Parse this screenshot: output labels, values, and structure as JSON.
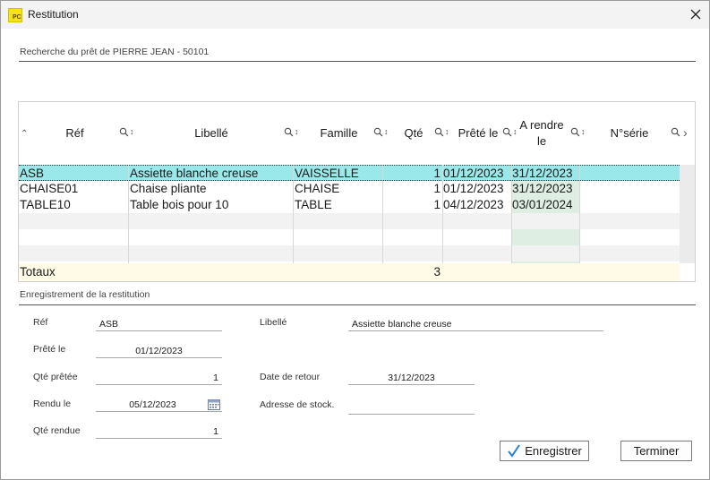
{
  "window": {
    "title": "Restitution",
    "app_icon_text": "PC"
  },
  "search": {
    "label": "Recherche du prêt de PIERRE JEAN - 50101"
  },
  "table": {
    "columns": [
      "Réf",
      "Libellé",
      "Famille",
      "Qté",
      "Prêté le",
      "A rendre le",
      "N°série"
    ],
    "rows": [
      {
        "ref": "ASB",
        "libelle": "Assiette blanche creuse",
        "famille": "VAISSELLE",
        "qte": "1",
        "prete_le": "01/12/2023",
        "a_rendre_le": "31/12/2023",
        "serie": ""
      },
      {
        "ref": "CHAISE01",
        "libelle": "Chaise pliante",
        "famille": "CHAISE",
        "qte": "1",
        "prete_le": "01/12/2023",
        "a_rendre_le": "31/12/2023",
        "serie": ""
      },
      {
        "ref": "TABLE10",
        "libelle": "Table bois pour 10",
        "famille": "TABLE",
        "qte": "1",
        "prete_le": "04/12/2023",
        "a_rendre_le": "03/01/2024",
        "serie": ""
      }
    ],
    "totals": {
      "label": "Totaux",
      "qte": "3"
    }
  },
  "form": {
    "section_label": "Enregistrement de la restitution",
    "ref_label": "Réf",
    "ref_value": "ASB",
    "libelle_label": "Libellé",
    "libelle_value": "Assiette blanche creuse",
    "prete_label": "Prêté le",
    "prete_value": "01/12/2023",
    "qte_pretee_label": "Qté prêtée",
    "qte_pretee_value": "1",
    "date_retour_label": "Date de retour",
    "date_retour_value": "31/12/2023",
    "rendu_label": "Rendu le",
    "rendu_value": "05/12/2023",
    "adresse_label": "Adresse de stock.",
    "adresse_value": "",
    "qte_rendue_label": "Qté rendue",
    "qte_rendue_value": "1"
  },
  "buttons": {
    "save_label": "Enregistrer",
    "finish_label": "Terminer"
  },
  "icons": {
    "close": "close-icon",
    "search": "magnifier-icon",
    "calendar": "calendar-icon",
    "check": "check-icon"
  },
  "colors": {
    "selected_row": "#9be8ea",
    "totals_bg": "#fffbe6",
    "return_col": "#dfeee3"
  }
}
